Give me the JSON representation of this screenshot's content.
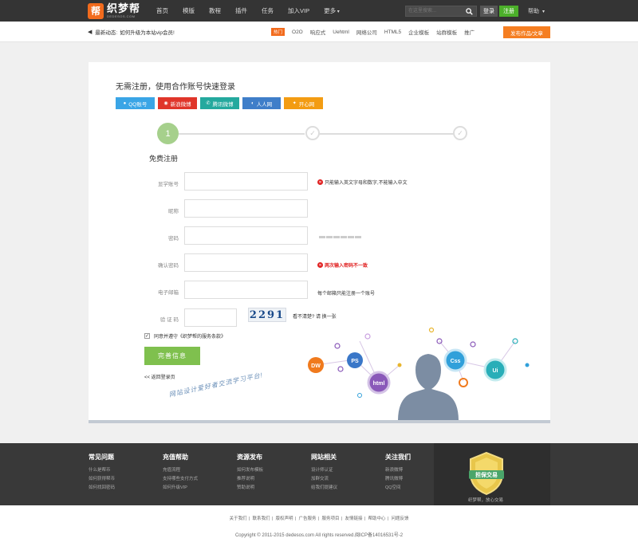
{
  "header": {
    "logo_mark": "帮",
    "logo_cn": "织梦帮",
    "logo_en": "DEDESOS.COM",
    "nav": [
      "首页",
      "模版",
      "教程",
      "插件",
      "任务",
      "加入VIP",
      "更多"
    ],
    "search_placeholder": "在这里搜索...",
    "login": "登录",
    "register": "注册",
    "help": "帮助"
  },
  "subbar": {
    "notice_label": "最新动态:",
    "notice_text": "如何升级为本站vip会员!",
    "hot": "热门",
    "tags": [
      "O2O",
      "响应式",
      "Uehtml",
      "网络公司",
      "HTML5",
      "企业模板",
      "站群模板",
      "推广"
    ],
    "publish": "发布作品/文章"
  },
  "card": {
    "title": "无需注册，使用合作账号快速登录",
    "social": [
      {
        "label": "QQ账号",
        "color": "#3aa5e6",
        "icon": "qq-icon"
      },
      {
        "label": "新浪微博",
        "color": "#e0352a",
        "icon": "weibo-icon"
      },
      {
        "label": "腾讯微博",
        "color": "#24a99e",
        "icon": "tencent-weibo-icon"
      },
      {
        "label": "人人网",
        "color": "#3f7ec9",
        "icon": "renren-icon"
      },
      {
        "label": "开心网",
        "color": "#f39c12",
        "icon": "kaixin-icon"
      }
    ],
    "steps": {
      "current": "1"
    },
    "reg_title": "免费注册",
    "fields": {
      "username": "显学账号",
      "nickname": "昵称",
      "password": "密码",
      "confirm": "确认密码",
      "email": "电子邮箱",
      "captcha": "验 证 码"
    },
    "hints": {
      "username": "只能输入英文字母和数字,不能输入中文",
      "confirm": "两次输入密码不一致",
      "email": "每个邮箱只能注册一个账号"
    },
    "captcha_text": "2291",
    "captcha_tip": "看不清楚? 请 换一张",
    "agree": "同意并遵守《织梦帮的服务条款》",
    "submit": "完善信息",
    "back": "<< 返回登录页",
    "slogan": "网站设计爱好者交流学习平台!",
    "bubbles": [
      "DW",
      "PS",
      "html",
      "Css",
      "Ui"
    ]
  },
  "footer": {
    "cols": [
      {
        "h": "常见问题",
        "items": [
          "什么是帮币",
          "如何获得帮币",
          "如何找回密码"
        ]
      },
      {
        "h": "充值帮助",
        "items": [
          "充值流程",
          "支持哪些支付方式",
          "如何升级VIP"
        ]
      },
      {
        "h": "资源发布",
        "items": [
          "如何发布模板",
          "推荐说明",
          "赞助说明"
        ]
      },
      {
        "h": "网站相关",
        "items": [
          "设计师认证",
          "加群交流",
          "给我们提建议"
        ]
      },
      {
        "h": "关注我们",
        "items": [
          "新浪微博",
          "腾讯微博",
          "QQ空间"
        ]
      }
    ],
    "badge": "担保交易",
    "badge_caption": "织梦帮，放心交易",
    "links": [
      "关于我们",
      "联系我们",
      "版权声明",
      "广告服务",
      "服务项目",
      "友情链接",
      "帮助中心",
      "问题反馈"
    ],
    "copyright": "Copyright © 2011-2015 dedesos.com All rights reserved.闽ICP备14016531号-2"
  }
}
